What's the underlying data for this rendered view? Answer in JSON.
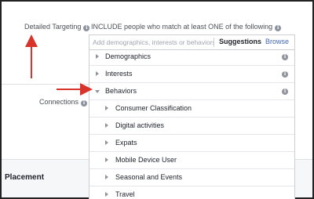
{
  "targeting": {
    "label": "Detailed Targeting",
    "include_text": "INCLUDE people who match at least ONE of the following",
    "search_placeholder": "Add demographics, interests or behaviors",
    "suggestions_label": "Suggestions",
    "browse_label": "Browse"
  },
  "connections": {
    "label": "Connections"
  },
  "placement": {
    "label": "Placement"
  },
  "dropdown": {
    "top_items": [
      {
        "label": "Demographics",
        "expanded": false
      },
      {
        "label": "Interests",
        "expanded": false
      },
      {
        "label": "Behaviors",
        "expanded": true
      }
    ],
    "behaviors_children": [
      {
        "label": "Consumer Classification"
      },
      {
        "label": "Digital activities"
      },
      {
        "label": "Expats"
      },
      {
        "label": "Mobile Device User"
      },
      {
        "label": "Seasonal and Events"
      },
      {
        "label": "Travel"
      }
    ]
  },
  "colors": {
    "arrow": "#d9342b",
    "link": "#4267b2",
    "border": "#ccd0d5"
  }
}
